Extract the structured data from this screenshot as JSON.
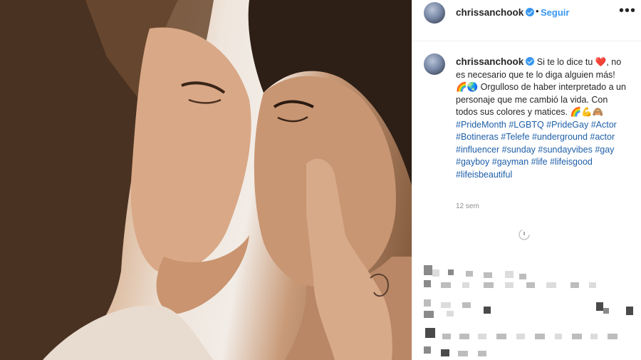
{
  "post": {
    "image_alt": "",
    "header": {
      "username": "chrissanchook",
      "separator": "•",
      "follow_label": "Seguir",
      "more_icon": "more-dots-icon",
      "verified_icon": "verified-badge-icon"
    },
    "caption": {
      "username": "chrissanchook",
      "text_parts": [
        "Si te lo dice tu",
        ", no es necesario que te lo diga alguien más!",
        "Orgulloso de haber interpretado a un personaje que me cambió la vida. Con todos sus colores y matices."
      ],
      "emoji": [
        "❤️",
        "🌈",
        "🌏",
        "🌈",
        "💪",
        "🙈"
      ],
      "hashtags": [
        "#PrideMonth",
        "#LGBTQ",
        "#PrideGay",
        "#Actor",
        "#Botineras",
        "#Telefe",
        "#underground",
        "#actor",
        "#influencer",
        "#sunday",
        "#sundayvibes",
        "#gay",
        "#gayboy",
        "#gayman",
        "#life",
        "#lifeisgood",
        "#lifeisbeautiful"
      ]
    },
    "timestamp": "12 sem"
  },
  "colors": {
    "accent": "#3897f0",
    "text": "#262626",
    "muted": "#8e8e8e"
  }
}
